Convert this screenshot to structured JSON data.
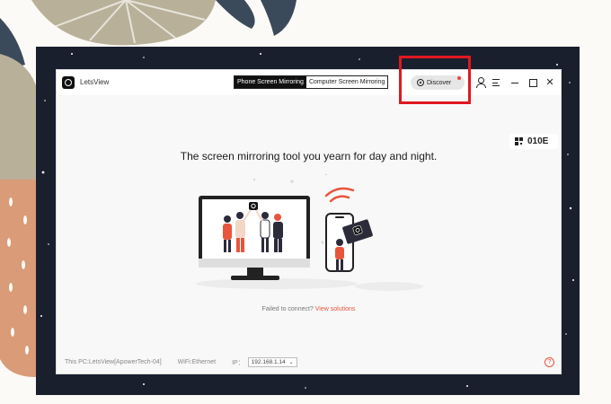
{
  "app": {
    "name": "LetsView"
  },
  "tabs": [
    {
      "label": "Phone Screen Mirroring",
      "active": true
    },
    {
      "label": "Computer Screen Mirroring",
      "active": false
    }
  ],
  "toolbar": {
    "discover_label": "Discover"
  },
  "code": {
    "value": "010E"
  },
  "main": {
    "tagline": "The screen mirroring tool you yearn for day and night."
  },
  "status": {
    "failed_text": "Failed to connect?",
    "link_text": "View solutions"
  },
  "footer": {
    "pc_label": "This PC:LetsView[ApowerTech-04]",
    "wifi_label": "WiFi:Ethernet",
    "ip_label": "IP：",
    "ip_value": "192.168.1.14"
  },
  "colors": {
    "accent": "#e8553c",
    "highlight": "#e0181e",
    "frame": "#1a1f2e"
  }
}
